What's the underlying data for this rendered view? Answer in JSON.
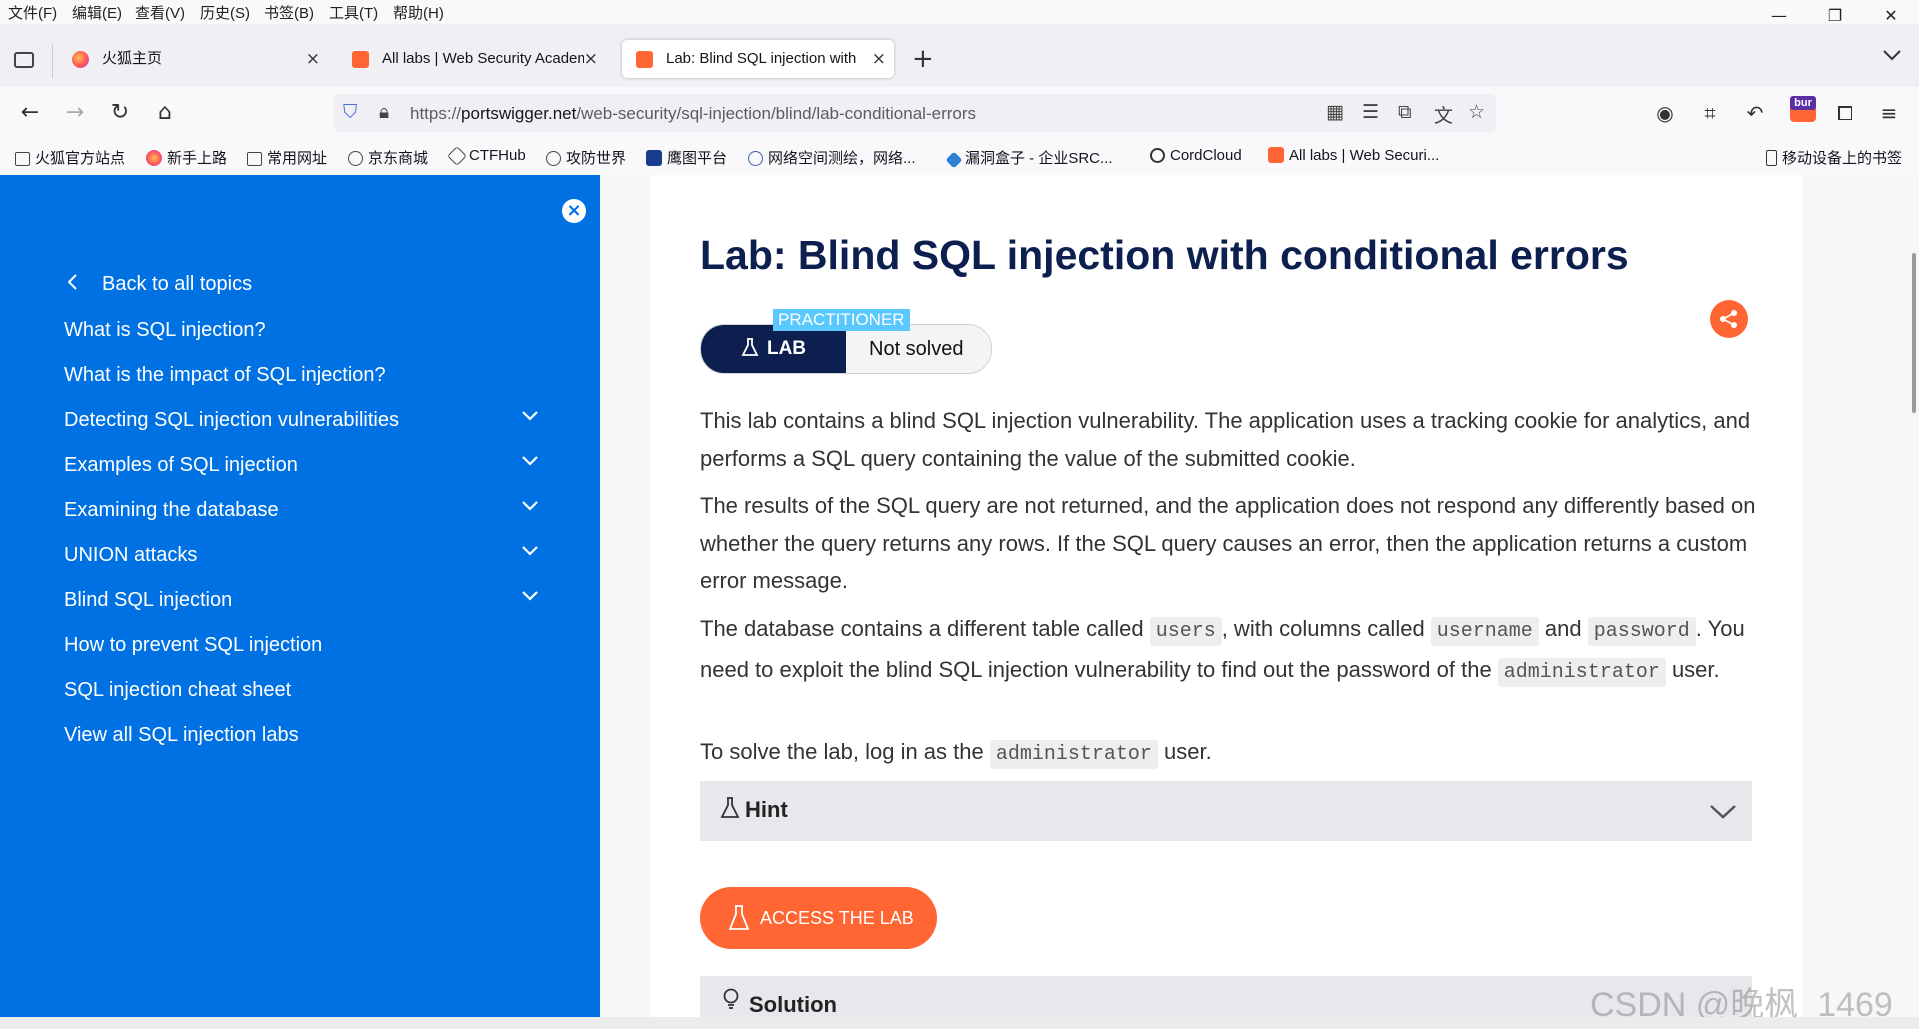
{
  "menu": [
    "文件(F)",
    "编辑(E)",
    "查看(V)",
    "历史(S)",
    "书签(B)",
    "工具(T)",
    "帮助(H)"
  ],
  "window_controls": {
    "minimize": "—",
    "restore": "❐",
    "close": "✕"
  },
  "tabs": [
    {
      "label": "火狐主页",
      "icon": "firefox-icon",
      "active": false
    },
    {
      "label": "All labs | Web Security Academy",
      "icon": "portswigger-icon",
      "active": false
    },
    {
      "label": "Lab: Blind SQL injection with",
      "icon": "portswigger-icon",
      "active": true
    }
  ],
  "new_tab_symbol": "+",
  "url": {
    "scheme": "https://",
    "host": "portswigger.net",
    "path": "/web-security/sql-injection/blind/lab-conditional-errors"
  },
  "bookmarks": [
    "火狐官方站点",
    "新手上路",
    "常用网址",
    "京东商城",
    "CTFHub",
    "攻防世界",
    "鹰图平台",
    "网络空间测绘，网络...",
    "漏洞盒子 - 企业SRC...",
    "CordCloud",
    "All labs | Web Securi..."
  ],
  "mobile_bookmarks": "移动设备上的书签",
  "burp_label": "bur",
  "sidebar": {
    "back": "Back to all topics",
    "items": [
      {
        "label": "What is SQL injection?",
        "expandable": false
      },
      {
        "label": "What is the impact of SQL injection?",
        "expandable": false
      },
      {
        "label": "Detecting SQL injection vulnerabilities",
        "expandable": true
      },
      {
        "label": "Examples of SQL injection",
        "expandable": true
      },
      {
        "label": "Examining the database",
        "expandable": true
      },
      {
        "label": "UNION attacks",
        "expandable": true
      },
      {
        "label": "Blind SQL injection",
        "expandable": true
      },
      {
        "label": "How to prevent SQL injection",
        "expandable": false
      },
      {
        "label": "SQL injection cheat sheet",
        "expandable": false
      },
      {
        "label": "View all SQL injection labs",
        "expandable": false
      }
    ]
  },
  "lab": {
    "title": "Lab: Blind SQL injection with conditional errors",
    "level": "PRACTITIONER",
    "badge": "LAB",
    "status": "Not solved"
  },
  "description": {
    "p1": "This lab contains a blind SQL injection vulnerability. The application uses a tracking cookie for analytics, and performs a SQL query containing the value of the submitted cookie.",
    "p2": "The results of the SQL query are not returned, and the application does not respond any differently based on whether the query returns any rows. If the SQL query causes an error, then the application returns a custom error message.",
    "p3_a": "The database contains a different table called ",
    "p3_code1": "users",
    "p3_b": ", with columns called ",
    "p3_code2": "username",
    "p3_c": " and ",
    "p3_code3": "password",
    "p3_d": ". You need to exploit the blind SQL injection vulnerability to find out the password of the ",
    "p3_code4": "administrator",
    "p3_e": " user.",
    "p4_a": "To solve the lab, log in as the ",
    "p4_code": "administrator",
    "p4_b": " user."
  },
  "hint_label": "Hint",
  "access_button": "ACCESS THE LAB",
  "solution_label": "Solution",
  "watermark": "CSDN @晚枫_1469",
  "colors": {
    "sidebar": "#0071e3",
    "accent": "#ff6633",
    "title": "#0c1f4e",
    "practitioner": "#58c8ff"
  }
}
